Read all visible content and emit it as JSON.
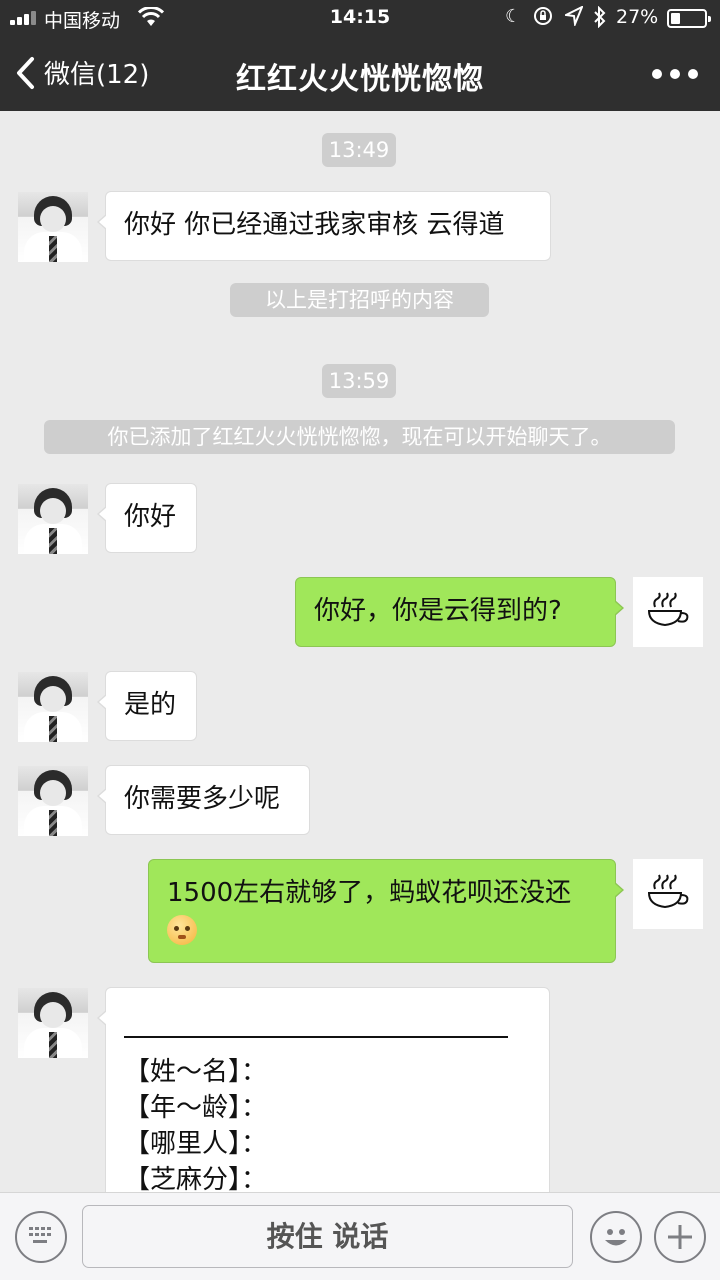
{
  "status_bar": {
    "carrier": "中国移动",
    "time": "14:15",
    "battery": "27%",
    "battery_level": 0.27,
    "icons": [
      "signal-icon",
      "wifi-icon",
      "moon-icon",
      "rotation-lock-icon",
      "location-icon",
      "bluetooth-icon",
      "battery-icon"
    ]
  },
  "nav": {
    "back_label": "微信(12)",
    "title": "红红火火恍恍惚惚",
    "more_icon": "more-icon"
  },
  "chat": {
    "timestamp_1": "13:49",
    "msg_1": "你好 你已经通过我家审核 云得道",
    "system_1": "以上是打招呼的内容",
    "timestamp_2": "13:59",
    "system_2": "你已添加了红红火火恍恍惚惚，现在可以开始聊天了。",
    "msg_2": "你好",
    "msg_3": "你好，你是云得到的?",
    "msg_4": "是的",
    "msg_5": "你需要多少呢",
    "msg_6": "1500左右就够了，蚂蚁花呗还没还",
    "form": {
      "row_1": "【姓～名】：",
      "row_2": "【年～龄】：",
      "row_3": "【哪里人】：",
      "row_4": "【芝麻分】："
    }
  },
  "toolbar": {
    "hold_to_talk": "按住 说话",
    "icons": [
      "keyboard-icon",
      "emoji-icon",
      "plus-icon"
    ]
  },
  "colors": {
    "header_bg": "#2f2f2f",
    "chat_bg": "#ebebeb",
    "outgoing_bubble": "#a0e75a",
    "incoming_bubble": "#ffffff",
    "system_pill": "#cecece"
  }
}
